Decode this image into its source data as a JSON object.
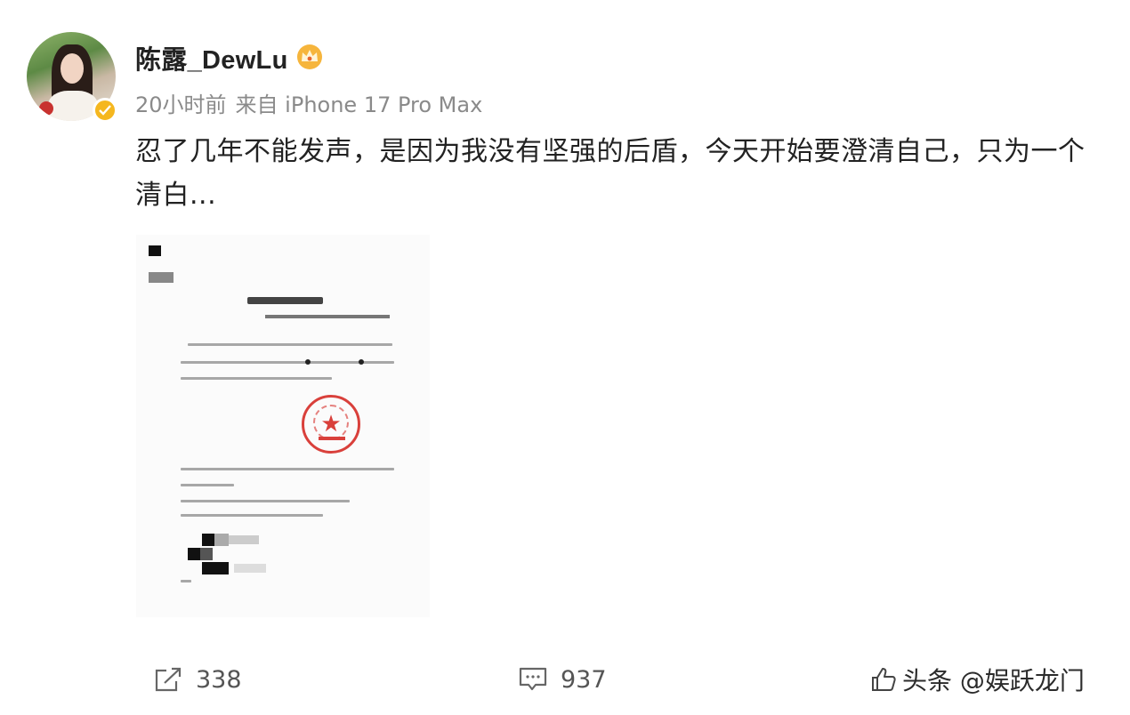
{
  "post": {
    "username": "陈露_DewLu",
    "time": "20小时前",
    "source": "来自 iPhone 17 Pro Max",
    "text": "忍了几年不能发声，是因为我没有坚强的后盾，今天开始要澄清自己，只为一个清白..."
  },
  "actions": {
    "repost_count": "338",
    "comment_count": "937"
  },
  "watermark": "头条 @娱跃龙门",
  "colors": {
    "badge": "#f5b71f",
    "seal": "#d9403b",
    "text": "#222222",
    "meta": "#8a8a8a"
  },
  "icons": [
    "verified-badge-icon",
    "crown-icon",
    "repost-icon",
    "comment-icon",
    "like-icon"
  ]
}
